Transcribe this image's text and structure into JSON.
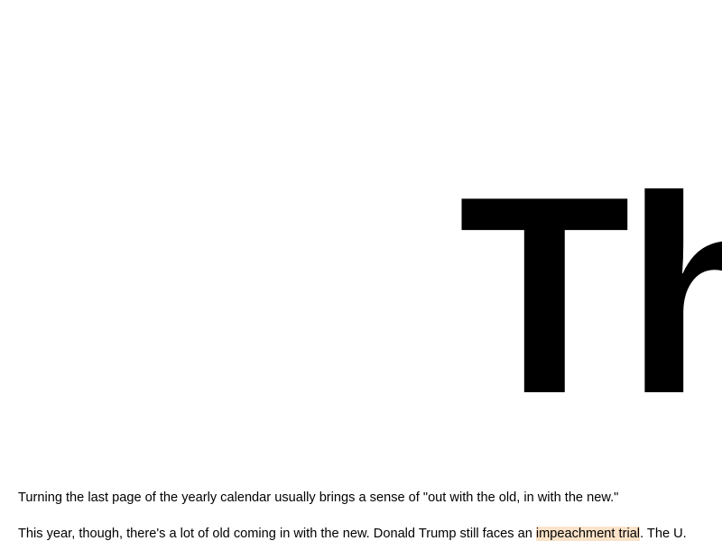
{
  "hero": {
    "title_fragment": "Th"
  },
  "article": {
    "paragraph_1": "Turning the last page of the yearly calendar usually brings a sense of \"out with the old, in with the new.\"",
    "paragraph_2_before": "This year, though, there's a lot of old coming in with the new. Donald Trump still faces an ",
    "paragraph_2_highlight": "impeachment trial",
    "paragraph_2_after": ". The U.",
    "highlight_color": "#fbe3c9"
  }
}
